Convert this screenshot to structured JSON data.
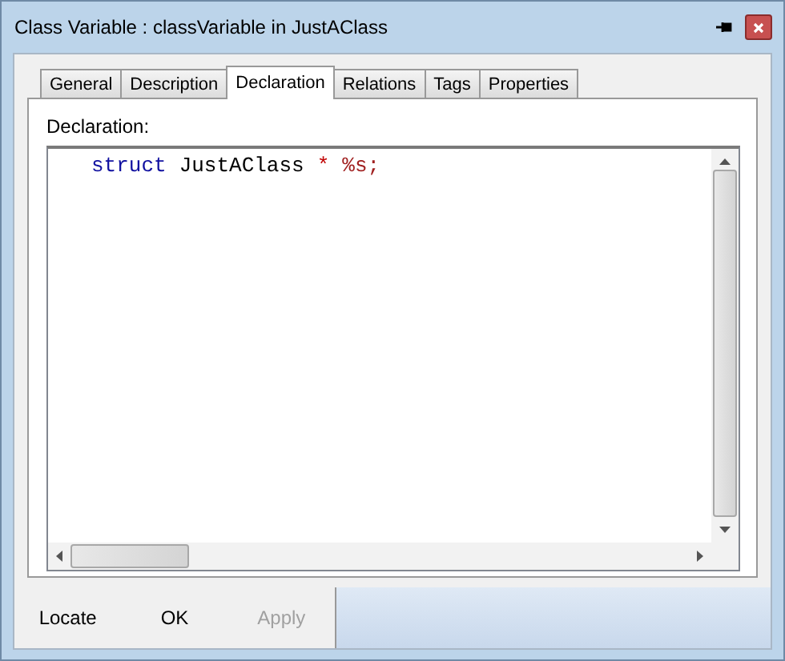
{
  "window": {
    "title": "Class Variable : classVariable in JustAClass"
  },
  "tabs": [
    {
      "label": "General",
      "selected": false
    },
    {
      "label": "Description",
      "selected": false
    },
    {
      "label": "Declaration",
      "selected": true
    },
    {
      "label": "Relations",
      "selected": false
    },
    {
      "label": "Tags",
      "selected": false
    },
    {
      "label": "Properties",
      "selected": false
    }
  ],
  "field_label": "Declaration:",
  "code": [
    {
      "text": "struct",
      "color": "#1010a0"
    },
    {
      "text": "JustAClass",
      "color": "#000000"
    },
    {
      "text": "*",
      "color": "#c00000"
    },
    {
      "text": "%s;",
      "color": "#a02020"
    }
  ],
  "buttons": [
    {
      "label": "Locate",
      "disabled": false
    },
    {
      "label": "OK",
      "disabled": false
    },
    {
      "label": "Apply",
      "disabled": true
    }
  ]
}
